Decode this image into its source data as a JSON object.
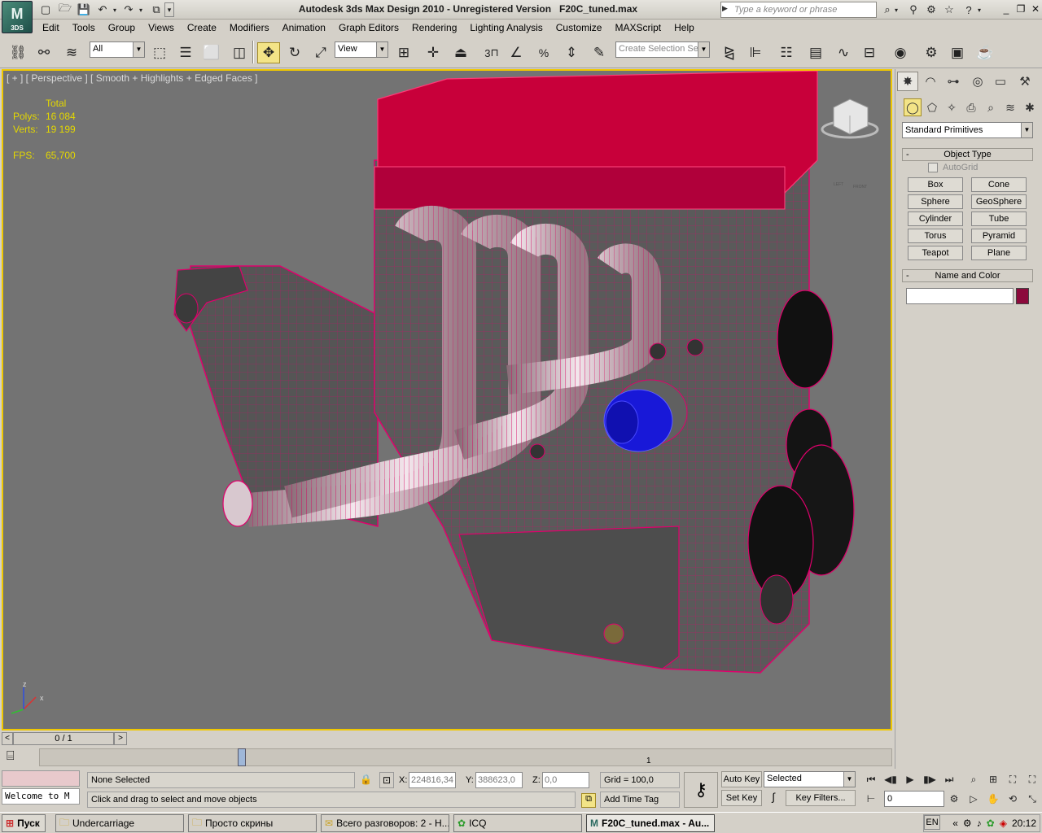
{
  "title": {
    "app_name": "Autodesk 3ds Max Design 2010",
    "license": "Unregistered Version",
    "file": "F20C_tuned.max",
    "logo": "3DS"
  },
  "search": {
    "placeholder": "Type a keyword or phrase"
  },
  "menu": [
    "Edit",
    "Tools",
    "Group",
    "Views",
    "Create",
    "Modifiers",
    "Animation",
    "Graph Editors",
    "Rendering",
    "Lighting Analysis",
    "Customize",
    "MAXScript",
    "Help"
  ],
  "toolbar": {
    "selection_filter": "All",
    "reference_coord": "View",
    "named_selection_placeholder": "Create Selection Se",
    "snap_value": "3",
    "percent_snap": "%"
  },
  "viewport": {
    "label": "[ + ] [ Perspective ] [ Smooth + Highlights + Edged Faces ]",
    "stats_header": "Total",
    "stats": [
      {
        "label": "Polys:",
        "value": "16 084"
      },
      {
        "label": "Verts:",
        "value": "19 199"
      }
    ],
    "fps_label": "FPS:",
    "fps_value": "65,700",
    "axis_x": "x",
    "axis_z": "z",
    "viewcube_labels": [
      "LEFT",
      "FRONT"
    ],
    "colors": {
      "head": "#c8003a",
      "wire": "#e0006c",
      "filter": "#1818d8",
      "body": "#5a5a5a",
      "background": "#737373",
      "active_border": "#f0c800"
    }
  },
  "command_panel": {
    "category_dropdown": "Standard Primitives",
    "object_type_title": "Object Type",
    "autogrid_label": "AutoGrid",
    "primitives": [
      "Box",
      "Cone",
      "Sphere",
      "GeoSphere",
      "Cylinder",
      "Tube",
      "Torus",
      "Pyramid",
      "Teapot",
      "Plane"
    ],
    "name_color_title": "Name and Color",
    "object_name": "",
    "object_color": "#8c0a3c"
  },
  "timeline": {
    "slider_label": "0 / 1",
    "tick": "1"
  },
  "status": {
    "maxscript_listener": "Welcome to M",
    "selection": "None Selected",
    "prompt": "Click and drag to select and move objects",
    "x_label": "X:",
    "x_value": "224816,34",
    "y_label": "Y:",
    "y_value": "388623,0",
    "z_label": "Z:",
    "z_value": "0,0",
    "grid": "Grid = 100,0",
    "add_time_tag": "Add Time Tag",
    "auto_key": "Auto Key",
    "set_key": "Set Key",
    "key_mode": "Selected",
    "key_filters": "Key Filters...",
    "frame": "0"
  },
  "taskbar": {
    "start": "Пуск",
    "items": [
      {
        "label": "Undercarriage",
        "icon": "folder-icon"
      },
      {
        "label": "Просто скрины",
        "icon": "folder-icon"
      },
      {
        "label": "Всего разговоров: 2 - Н...",
        "icon": "chat-icon"
      },
      {
        "label": "ICQ",
        "icon": "icq-icon"
      },
      {
        "label": "F20C_tuned.max - Au...",
        "icon": "max-icon"
      }
    ],
    "lang": "EN",
    "time": "20:12"
  }
}
